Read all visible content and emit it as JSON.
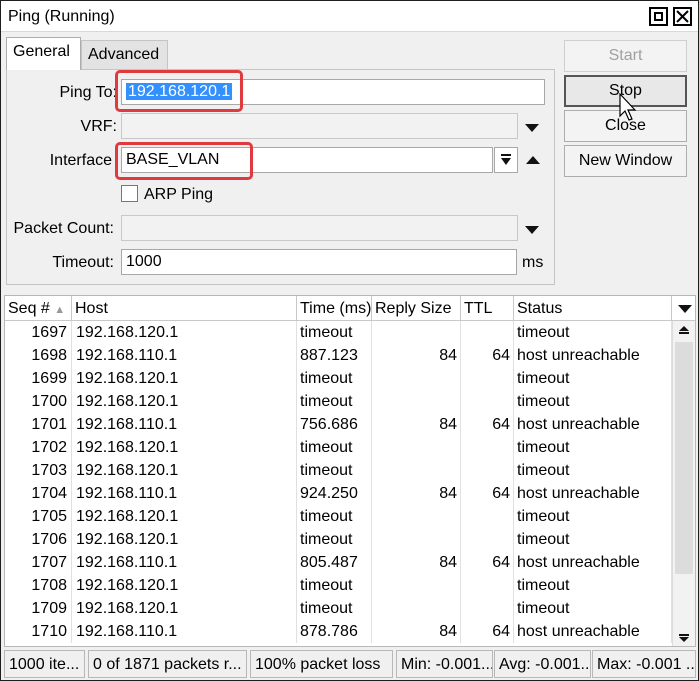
{
  "window": {
    "title": "Ping (Running)"
  },
  "tabs": [
    {
      "label": "General",
      "active": true
    },
    {
      "label": "Advanced",
      "active": false
    }
  ],
  "form": {
    "ping_to_label": "Ping To:",
    "ping_to_value": "192.168.120.1",
    "vrf_label": "VRF:",
    "vrf_value": "",
    "interface_label": "Interface",
    "interface_value": "BASE_VLAN",
    "arp_ping_label": "ARP Ping",
    "arp_ping_checked": false,
    "packet_count_label": "Packet Count:",
    "packet_count_value": "",
    "timeout_label": "Timeout:",
    "timeout_value": "1000",
    "timeout_unit": "ms"
  },
  "buttons": {
    "start": "Start",
    "stop": "Stop",
    "close": "Close",
    "new_window": "New Window"
  },
  "table": {
    "columns": [
      "Seq #",
      "Host",
      "Time (ms)",
      "Reply Size",
      "TTL",
      "Status"
    ],
    "rows": [
      {
        "seq": "1697",
        "host": "192.168.120.1",
        "time": "timeout",
        "size": "",
        "ttl": "",
        "status": "timeout"
      },
      {
        "seq": "1698",
        "host": "192.168.110.1",
        "time": "887.123",
        "size": "84",
        "ttl": "64",
        "status": "host unreachable"
      },
      {
        "seq": "1699",
        "host": "192.168.120.1",
        "time": "timeout",
        "size": "",
        "ttl": "",
        "status": "timeout"
      },
      {
        "seq": "1700",
        "host": "192.168.120.1",
        "time": "timeout",
        "size": "",
        "ttl": "",
        "status": "timeout"
      },
      {
        "seq": "1701",
        "host": "192.168.110.1",
        "time": "756.686",
        "size": "84",
        "ttl": "64",
        "status": "host unreachable"
      },
      {
        "seq": "1702",
        "host": "192.168.120.1",
        "time": "timeout",
        "size": "",
        "ttl": "",
        "status": "timeout"
      },
      {
        "seq": "1703",
        "host": "192.168.120.1",
        "time": "timeout",
        "size": "",
        "ttl": "",
        "status": "timeout"
      },
      {
        "seq": "1704",
        "host": "192.168.110.1",
        "time": "924.250",
        "size": "84",
        "ttl": "64",
        "status": "host unreachable"
      },
      {
        "seq": "1705",
        "host": "192.168.120.1",
        "time": "timeout",
        "size": "",
        "ttl": "",
        "status": "timeout"
      },
      {
        "seq": "1706",
        "host": "192.168.120.1",
        "time": "timeout",
        "size": "",
        "ttl": "",
        "status": "timeout"
      },
      {
        "seq": "1707",
        "host": "192.168.110.1",
        "time": "805.487",
        "size": "84",
        "ttl": "64",
        "status": "host unreachable"
      },
      {
        "seq": "1708",
        "host": "192.168.120.1",
        "time": "timeout",
        "size": "",
        "ttl": "",
        "status": "timeout"
      },
      {
        "seq": "1709",
        "host": "192.168.120.1",
        "time": "timeout",
        "size": "",
        "ttl": "",
        "status": "timeout"
      },
      {
        "seq": "1710",
        "host": "192.168.110.1",
        "time": "878.786",
        "size": "84",
        "ttl": "64",
        "status": "host unreachable"
      }
    ]
  },
  "status_bar": {
    "items": "1000 ite...",
    "packets": "0 of 1871 packets r...",
    "loss": "100% packet loss",
    "min": "Min: -0.001...",
    "avg": "Avg: -0.001...",
    "max": "Max: -0.001 ..."
  },
  "colors": {
    "highlight": "#e0393e",
    "selection": "#3390ff"
  }
}
